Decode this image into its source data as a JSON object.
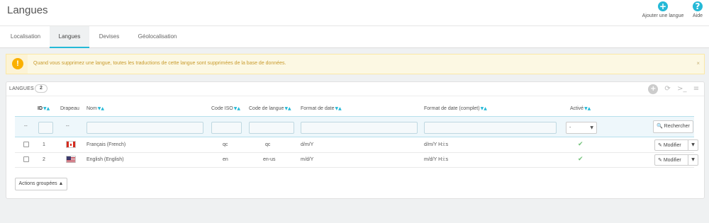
{
  "header": {
    "title": "Langues",
    "add_label": "Ajouter une langue",
    "add_icon": "plus-circle-icon",
    "help_label": "Aide",
    "help_icon": "question-circle-icon"
  },
  "tabs": [
    {
      "label": "Localisation",
      "active": false
    },
    {
      "label": "Langues",
      "active": true
    },
    {
      "label": "Devises",
      "active": false
    },
    {
      "label": "Géolocalisation",
      "active": false
    }
  ],
  "alert": {
    "icon": "!",
    "text": "Quand vous supprimez une langue, toutes les traductions de cette langue sont supprimées de la base de données.",
    "close": "×"
  },
  "panel": {
    "title": "LANGUES",
    "count": "2"
  },
  "table": {
    "columns": {
      "id": "ID",
      "flag": "Drapeau",
      "name": "Nom",
      "iso": "Code ISO",
      "lang_code": "Code de langue",
      "date_format": "Format de date",
      "date_format_full": "Format de date (complet)",
      "active": "Activé"
    },
    "sort_glyph": "▼▲",
    "filter": {
      "dash": "--",
      "active_value": "-",
      "search_label": "Rechercher"
    },
    "rows": [
      {
        "id": "1",
        "flag": "canada-flag-icon",
        "name": "Français (French)",
        "iso": "qc",
        "lang_code": "qc",
        "date_format": "d/m/Y",
        "date_format_full": "d/m/Y H:i:s",
        "active": true,
        "action": "Modifier"
      },
      {
        "id": "2",
        "flag": "usa-flag-icon",
        "name": "English (English)",
        "iso": "en",
        "lang_code": "en-us",
        "date_format": "m/d/Y",
        "date_format_full": "m/d/Y H:i:s",
        "active": true,
        "action": "Modifier"
      }
    ]
  },
  "bulk_actions": "Actions groupées ▲",
  "colors": {
    "accent": "#25b9d7",
    "warning_bg": "#fcf8e3",
    "warning_icon": "#fab000",
    "success": "#72c279"
  }
}
